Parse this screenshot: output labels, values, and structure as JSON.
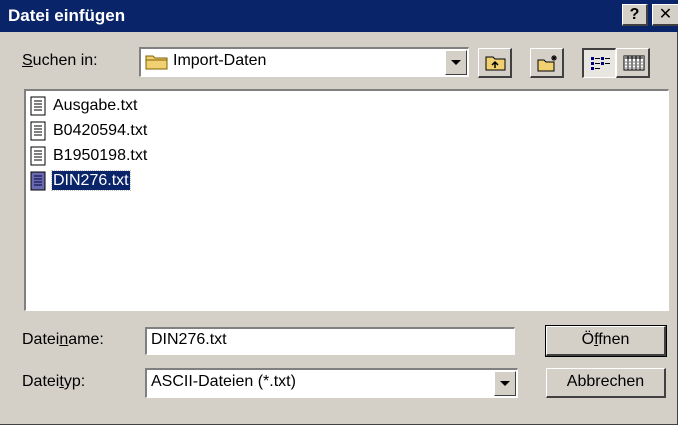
{
  "window": {
    "title": "Datei einfügen",
    "help_label": "?",
    "close_label": "✕"
  },
  "lookin": {
    "label_pre": "",
    "label_accel": "S",
    "label_post": "uchen in:",
    "folder_icon": "folder-icon",
    "value": "Import-Daten"
  },
  "toolbar": {
    "up_icon": "folder-up-icon",
    "newfolder_icon": "new-folder-icon",
    "list_icon": "list-view-icon",
    "details_icon": "details-view-icon"
  },
  "files": [
    {
      "name": "Ausgabe.txt",
      "icon": "text-file-icon",
      "selected": false
    },
    {
      "name": "B0420594.txt",
      "icon": "text-file-icon",
      "selected": false
    },
    {
      "name": "B1950198.txt",
      "icon": "text-file-icon",
      "selected": false
    },
    {
      "name": "DIN276.txt",
      "icon": "text-file-icon",
      "selected": true
    }
  ],
  "filename": {
    "label_pre": "Datei",
    "label_accel": "n",
    "label_post": "ame:",
    "value": "DIN276.txt"
  },
  "filetype": {
    "label_pre": "Datei",
    "label_accel": "t",
    "label_post": "yp:",
    "value": "ASCII-Dateien (*.txt)"
  },
  "buttons": {
    "open_pre": "Ö",
    "open_accel": "f",
    "open_post": "fnen",
    "cancel": "Abbrechen"
  },
  "colors": {
    "titlebar": "#0a246a",
    "face": "#d4d0c8",
    "selection": "#0a246a"
  }
}
